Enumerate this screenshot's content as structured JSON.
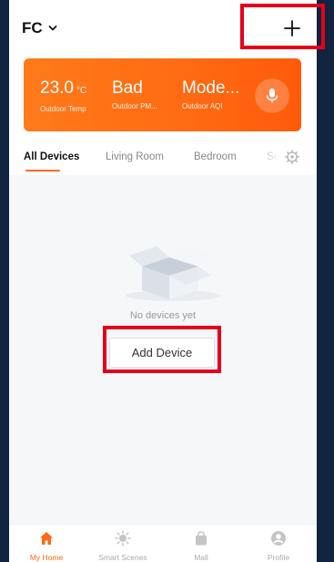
{
  "header": {
    "home_name": "FC",
    "add_symbol": "+"
  },
  "weather": {
    "temp": {
      "value": "23.0",
      "unit": "°C",
      "label": "Outdoor Temp"
    },
    "pm": {
      "value": "Bad",
      "label": "Outdoor PM..."
    },
    "aqi": {
      "value": "Mode...",
      "label": "Outdoor AQI"
    }
  },
  "tabs": [
    {
      "label": "All Devices",
      "active": true
    },
    {
      "label": "Living Room"
    },
    {
      "label": "Bedroom"
    },
    {
      "label": "Se"
    }
  ],
  "empty": {
    "text": "No devices yet",
    "button": "Add Device"
  },
  "nav": [
    {
      "label": "My Home",
      "icon": "home-icon",
      "active": true
    },
    {
      "label": "Smart Scenes",
      "icon": "sun-icon"
    },
    {
      "label": "Mall",
      "icon": "shopping-bag-icon"
    },
    {
      "label": "Profile",
      "icon": "profile-icon"
    }
  ],
  "colors": {
    "accent": "#ff6a12",
    "highlight": "#e5001a",
    "frame_bg": "#10243f"
  }
}
